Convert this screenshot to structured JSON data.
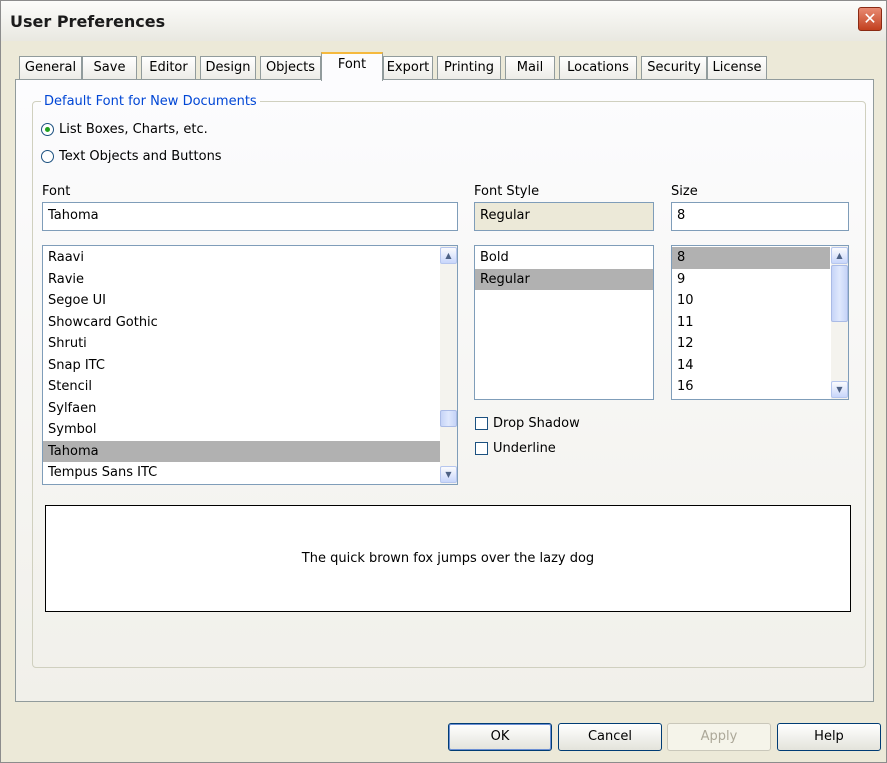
{
  "window": {
    "title": "User Preferences",
    "close_glyph": "✕"
  },
  "tabs": [
    {
      "label": "General"
    },
    {
      "label": "Save"
    },
    {
      "label": "Editor"
    },
    {
      "label": "Design"
    },
    {
      "label": "Objects"
    },
    {
      "label": "Font"
    },
    {
      "label": "Export"
    },
    {
      "label": "Printing"
    },
    {
      "label": "Mail"
    },
    {
      "label": "Locations"
    },
    {
      "label": "Security"
    },
    {
      "label": "License"
    }
  ],
  "active_tab": "Font",
  "group": {
    "legend": "Default Font for New Documents",
    "radio_list_boxes": "List Boxes, Charts, etc.",
    "radio_text_objects": "Text Objects and Buttons",
    "selected_radio": "List Boxes, Charts, etc."
  },
  "font": {
    "label": "Font",
    "value": "Tahoma",
    "items": [
      "Raavi",
      "Ravie",
      "Segoe UI",
      "Showcard Gothic",
      "Shruti",
      "Snap ITC",
      "Stencil",
      "Sylfaen",
      "Symbol",
      "Tahoma",
      "Tempus Sans ITC"
    ],
    "selected": "Tahoma"
  },
  "font_style": {
    "label": "Font Style",
    "value": "Regular",
    "items": [
      "Bold",
      "Regular"
    ],
    "selected": "Regular"
  },
  "size": {
    "label": "Size",
    "value": "8",
    "items": [
      "8",
      "9",
      "10",
      "11",
      "12",
      "14",
      "16"
    ],
    "selected": "8"
  },
  "effects": {
    "drop_shadow": "Drop Shadow",
    "underline": "Underline",
    "drop_shadow_checked": false,
    "underline_checked": false
  },
  "preview_text": "The quick brown fox jumps over the lazy dog",
  "buttons": {
    "ok": "OK",
    "cancel": "Cancel",
    "apply": "Apply",
    "help": "Help"
  },
  "icons": {
    "close": "close-icon",
    "scroll_up": "scroll-up-arrow-icon",
    "scroll_down": "scroll-down-arrow-icon"
  },
  "colors": {
    "legend": "#0046d5",
    "active_tab_accent": "#f5b93e",
    "selection": "#b1b1b1",
    "close_button": "#c2401f"
  }
}
